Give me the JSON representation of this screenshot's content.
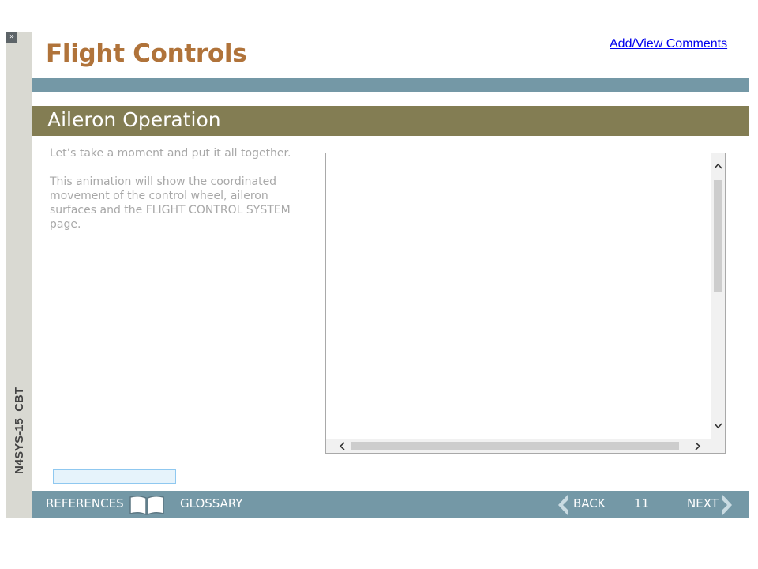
{
  "sidebar": {
    "expand_glyph": "»",
    "course_id": "N4SYS-15_CBT"
  },
  "header": {
    "title": "Flight Controls",
    "comments_link": "Add/View Comments"
  },
  "section": {
    "title": "Aileron Operation"
  },
  "content": {
    "paragraphs": [
      "Let’s take a moment and put it all together.",
      "This animation will show the coordinated movement of the control wheel, aileron surfaces and the FLIGHT CONTROL SYSTEM page."
    ]
  },
  "animation_frame": {
    "scroll_up": "^",
    "scroll_down": "v",
    "scroll_left": "<",
    "scroll_right": ">"
  },
  "footer": {
    "references": "REFERENCES",
    "glossary": "GLOSSARY",
    "back": "BACK",
    "page_number": "11",
    "next": "NEXT"
  },
  "colors": {
    "title": "#b0733a",
    "band": "#7498a6",
    "section_bar": "#837d53",
    "sidebar": "#d9d9d2"
  }
}
